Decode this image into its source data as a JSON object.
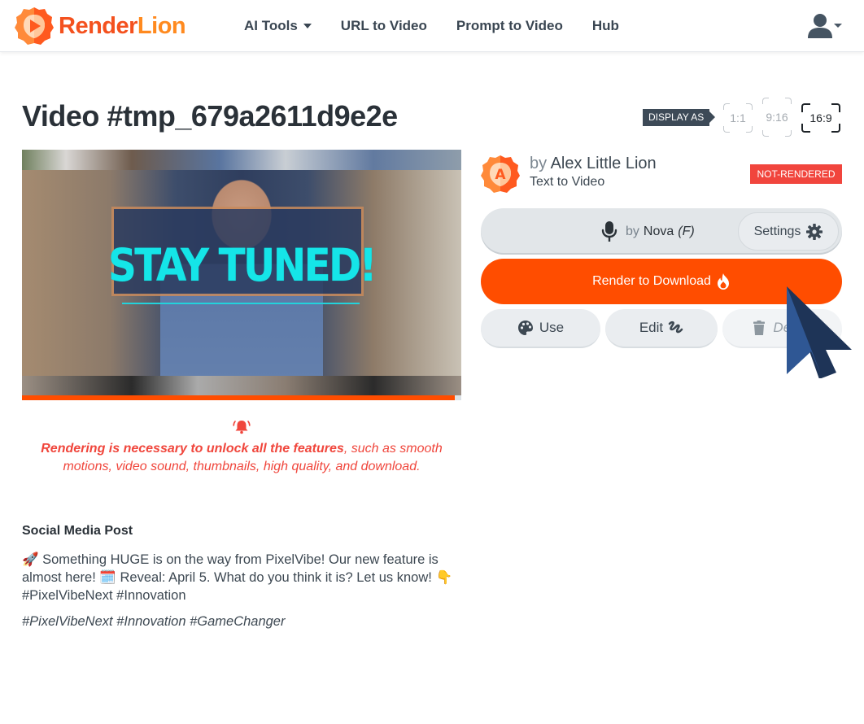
{
  "navbar": {
    "brand": {
      "part1": "Render",
      "part2": "Lion"
    },
    "links": [
      {
        "label": "AI Tools",
        "has_dropdown": true
      },
      {
        "label": "URL to Video"
      },
      {
        "label": "Prompt to Video"
      },
      {
        "label": "Hub"
      }
    ],
    "user_icon": "user-icon"
  },
  "page": {
    "title": "Video #tmp_679a2611d9e2e",
    "display_as_label": "DISPLAY AS",
    "ratios": [
      {
        "label": "1:1",
        "active": false
      },
      {
        "label": "9:16",
        "active": false
      },
      {
        "label": "16:9",
        "active": true
      }
    ]
  },
  "video": {
    "overlay_text": "STAY TUNED!",
    "progress_percent": 98.5,
    "colors": {
      "progress": "#ff4d00",
      "overlay_text": "#15e5e8"
    }
  },
  "alert": {
    "icon": "bell-ringing-icon",
    "bold_text": "Rendering is necessary to unlock all the features",
    "rest_text": ", such as smooth motions, video sound, thumbnails, high quality, and download.",
    "color": "#f0463c"
  },
  "social": {
    "title": "Social Media Post",
    "body": "🚀 Something HUGE is on the way from PixelVibe! Our new feature is almost here! 🗓️ Reveal: April 5. What do you think it is? Let us know! 👇 #PixelVibeNext #Innovation",
    "tags": "#PixelVibeNext #Innovation #GameChanger"
  },
  "author": {
    "avatar_letter": "A",
    "by": "by",
    "name": "Alex Little Lion",
    "type": "Text to Video",
    "status": "NOT-RENDERED",
    "status_color": "#f1453d"
  },
  "voice": {
    "by": "by",
    "name": "Nova",
    "gender": "(F)",
    "settings_label": "Settings"
  },
  "actions": {
    "render_label": "Render to Download",
    "use_label": "Use",
    "edit_label": "Edit",
    "delete_label": "Delete",
    "accent_color": "#ff4d00"
  }
}
